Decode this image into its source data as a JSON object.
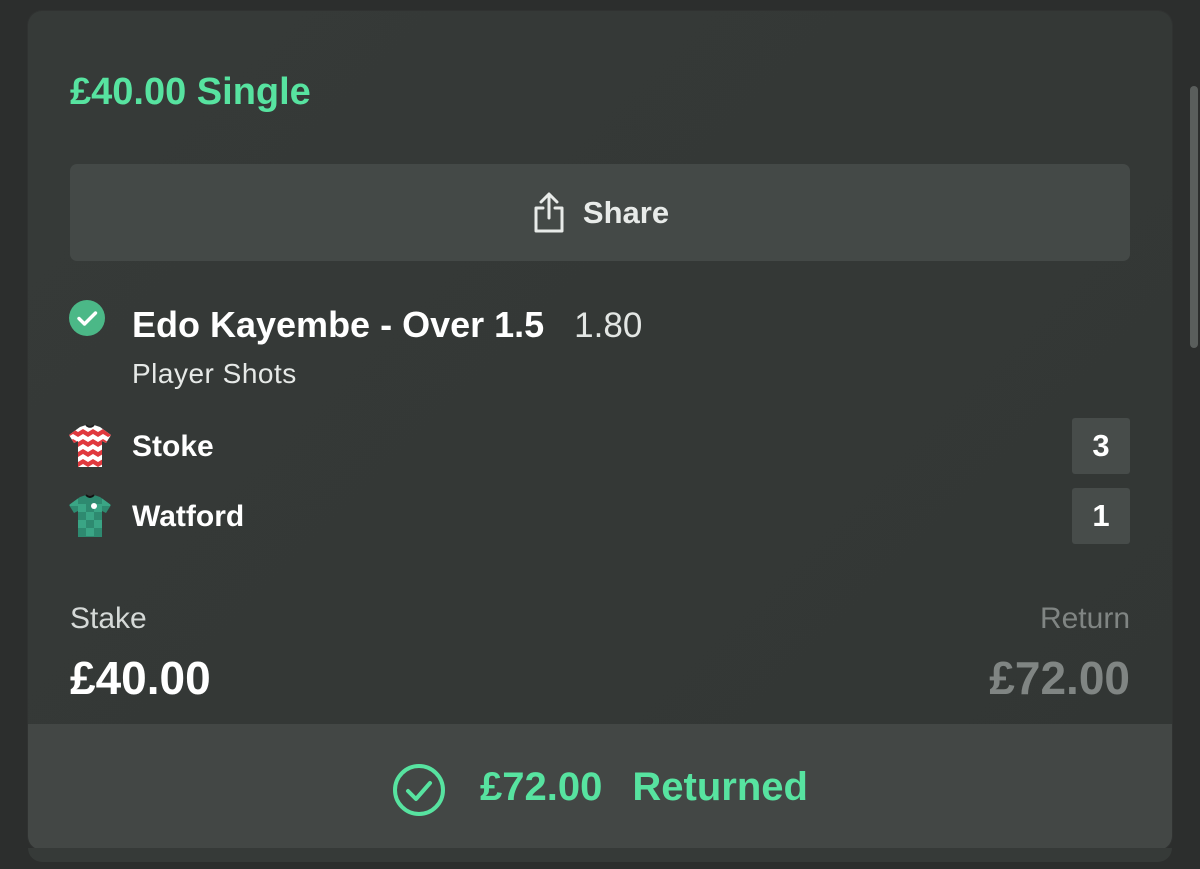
{
  "bet": {
    "title": "£40.00 Single"
  },
  "share": {
    "label": "Share",
    "icon": "share-icon"
  },
  "selection": {
    "status_icon": "check-circle-icon",
    "name": "Edo Kayembe - Over 1.5",
    "odds": "1.80",
    "market": "Player Shots"
  },
  "teams": [
    {
      "name": "Stoke",
      "score": "3",
      "shirt_icon": "stoke-shirt-icon"
    },
    {
      "name": "Watford",
      "score": "1",
      "shirt_icon": "watford-shirt-icon"
    }
  ],
  "summary": {
    "stake_label": "Stake",
    "stake_value": "£40.00",
    "return_label": "Return",
    "return_value": "£72.00"
  },
  "result": {
    "icon": "check-circle-outline-icon",
    "amount": "£72.00",
    "status": "Returned"
  },
  "colors": {
    "accent": "#57e3a0",
    "card_bg": "#363a38",
    "page_bg": "#2c2e2d",
    "muted_text": "#808583"
  }
}
